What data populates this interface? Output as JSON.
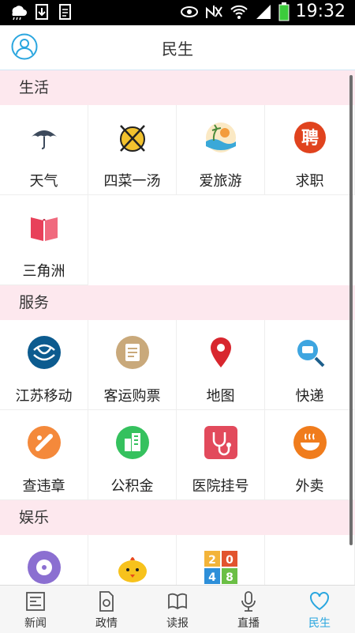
{
  "status_bar": {
    "time": "19:32"
  },
  "header": {
    "title": "民生"
  },
  "sections": [
    {
      "title": "生活",
      "items": [
        {
          "label": "天气",
          "icon": "umbrella-icon"
        },
        {
          "label": "四菜一汤",
          "icon": "dish-icon"
        },
        {
          "label": "爱旅游",
          "icon": "beach-icon"
        },
        {
          "label": "求职",
          "icon": "job-icon"
        },
        {
          "label": "三角洲",
          "icon": "book-icon"
        }
      ]
    },
    {
      "title": "服务",
      "items": [
        {
          "label": "江苏移动",
          "icon": "china-mobile-icon"
        },
        {
          "label": "客运购票",
          "icon": "ticket-icon"
        },
        {
          "label": "地图",
          "icon": "map-pin-icon"
        },
        {
          "label": "快递",
          "icon": "express-search-icon"
        },
        {
          "label": "查违章",
          "icon": "violation-icon"
        },
        {
          "label": "公积金",
          "icon": "building-icon"
        },
        {
          "label": "医院挂号",
          "icon": "stethoscope-icon"
        },
        {
          "label": "外卖",
          "icon": "bowl-icon"
        }
      ]
    },
    {
      "title": "娱乐",
      "items": [
        {
          "label": "",
          "icon": "film-icon"
        },
        {
          "label": "",
          "icon": "chick-icon"
        },
        {
          "label": "",
          "icon": "2048-game-icon"
        }
      ]
    }
  ],
  "tab_bar": [
    {
      "label": "新闻",
      "icon": "news-icon"
    },
    {
      "label": "政情",
      "icon": "document-icon"
    },
    {
      "label": "读报",
      "icon": "newspaper-icon"
    },
    {
      "label": "直播",
      "icon": "microphone-icon"
    },
    {
      "label": "民生",
      "icon": "heart-icon",
      "active": true
    }
  ],
  "colors": {
    "accent": "#2aa6df",
    "section_bg": "#fde8ee"
  }
}
